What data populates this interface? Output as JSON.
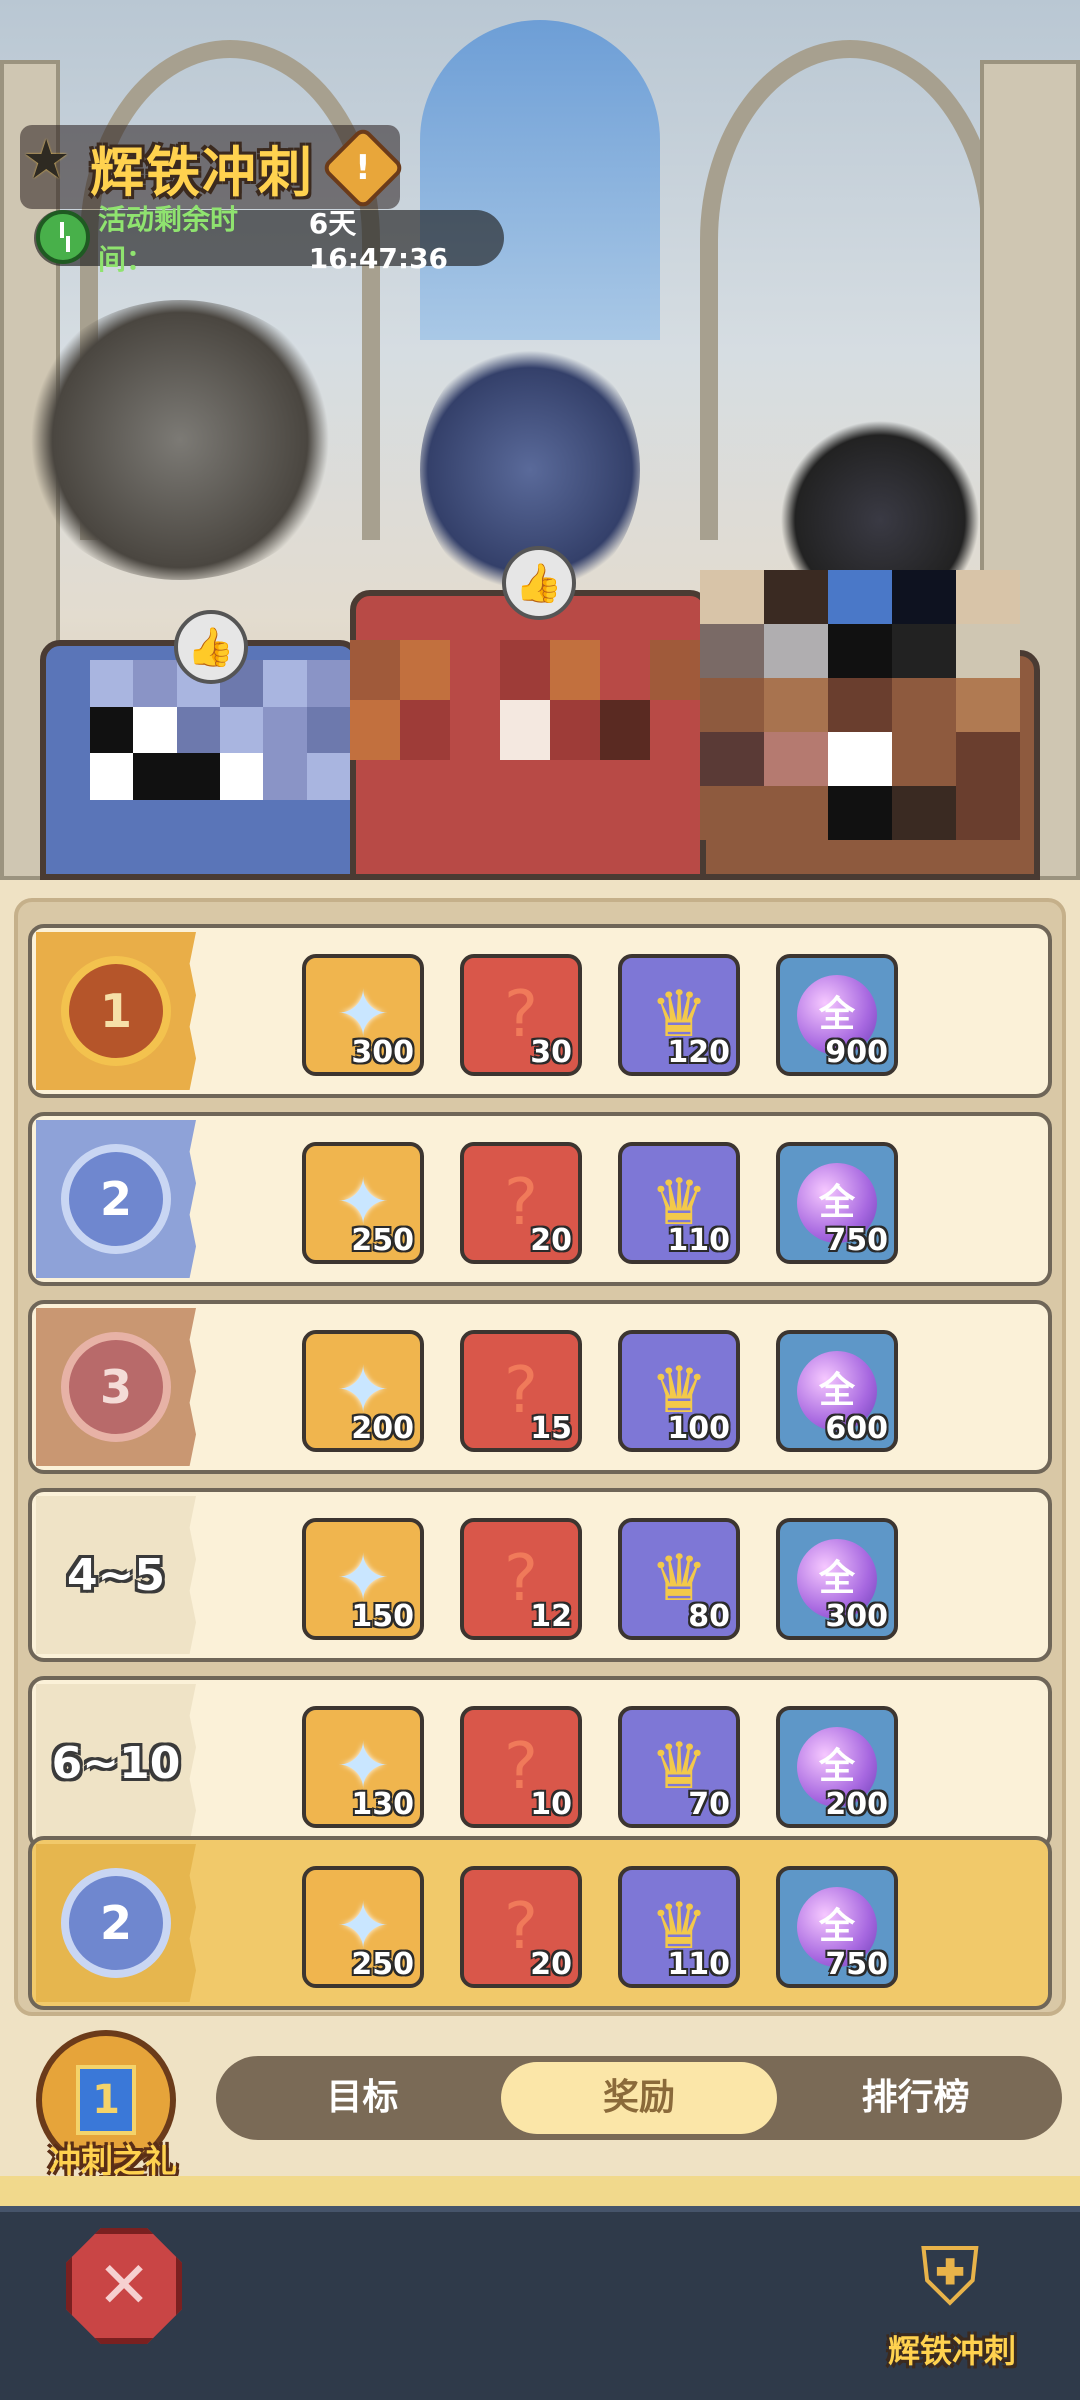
{
  "event": {
    "title": "辉铁冲刺",
    "timer_label": "活动剩余时间：",
    "timer_value": "6天 16:47:36"
  },
  "rewards": [
    {
      "rank": "1",
      "rank_style": "gold",
      "items": [
        {
          "icon": "crystal-icon",
          "qty": "300"
        },
        {
          "icon": "puzzle-icon",
          "qty": "30"
        },
        {
          "icon": "ticket-icon",
          "qty": "120"
        },
        {
          "icon": "orb-icon",
          "qty": "900"
        }
      ]
    },
    {
      "rank": "2",
      "rank_style": "silver",
      "items": [
        {
          "icon": "crystal-icon",
          "qty": "250"
        },
        {
          "icon": "puzzle-icon",
          "qty": "20"
        },
        {
          "icon": "ticket-icon",
          "qty": "110"
        },
        {
          "icon": "orb-icon",
          "qty": "750"
        }
      ]
    },
    {
      "rank": "3",
      "rank_style": "bronze",
      "items": [
        {
          "icon": "crystal-icon",
          "qty": "200"
        },
        {
          "icon": "puzzle-icon",
          "qty": "15"
        },
        {
          "icon": "ticket-icon",
          "qty": "100"
        },
        {
          "icon": "orb-icon",
          "qty": "600"
        }
      ]
    },
    {
      "rank": "4~5",
      "rank_style": "plain",
      "items": [
        {
          "icon": "crystal-icon",
          "qty": "150"
        },
        {
          "icon": "puzzle-icon",
          "qty": "12"
        },
        {
          "icon": "ticket-icon",
          "qty": "80"
        },
        {
          "icon": "orb-icon",
          "qty": "300"
        }
      ]
    },
    {
      "rank": "6~10",
      "rank_style": "plain",
      "items": [
        {
          "icon": "crystal-icon",
          "qty": "130"
        },
        {
          "icon": "puzzle-icon",
          "qty": "10"
        },
        {
          "icon": "ticket-icon",
          "qty": "70"
        },
        {
          "icon": "orb-icon",
          "qty": "200"
        }
      ]
    }
  ],
  "my_reward": {
    "rank": "2",
    "rank_style": "silver",
    "items": [
      {
        "icon": "crystal-icon",
        "qty": "250"
      },
      {
        "icon": "puzzle-icon",
        "qty": "20"
      },
      {
        "icon": "ticket-icon",
        "qty": "110"
      },
      {
        "icon": "orb-icon",
        "qty": "750"
      }
    ]
  },
  "orb_glyph": "全",
  "puzzle_glyph": "?",
  "tabs": [
    {
      "label": "目标",
      "active": false
    },
    {
      "label": "奖励",
      "active": true
    },
    {
      "label": "排行榜",
      "active": false
    }
  ],
  "gift": {
    "label": "冲刺之礼",
    "badge": "1"
  },
  "bottom": {
    "mode_label": "辉铁冲刺"
  },
  "colors": {
    "accent_gold": "#ffd24f",
    "panel": "#fbf1d8",
    "highlight": "#f1c96a"
  }
}
